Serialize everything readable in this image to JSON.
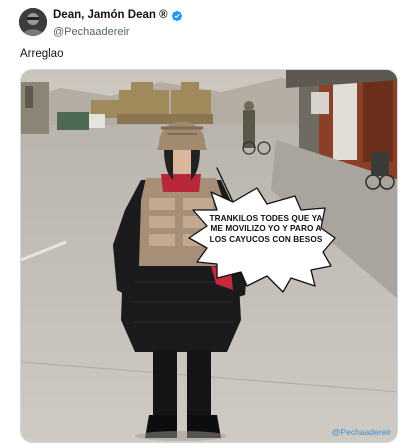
{
  "tweet": {
    "display_name": "Dean, Jamón Dean ®",
    "handle": "@Pechaadereir",
    "text": "Arreglao"
  },
  "media": {
    "speech_bubble": "TRANKILOS TODES QUE YA ME MOVILIZO YO Y PARO A LOS CAYUCOS CON BESOS",
    "watermark": "@Pechaadereir"
  },
  "icons": {
    "verified": "verified-badge-icon"
  },
  "colors": {
    "verified_blue": "#1d9bf0",
    "handle_gray": "#536471",
    "border": "#cfd9de"
  }
}
